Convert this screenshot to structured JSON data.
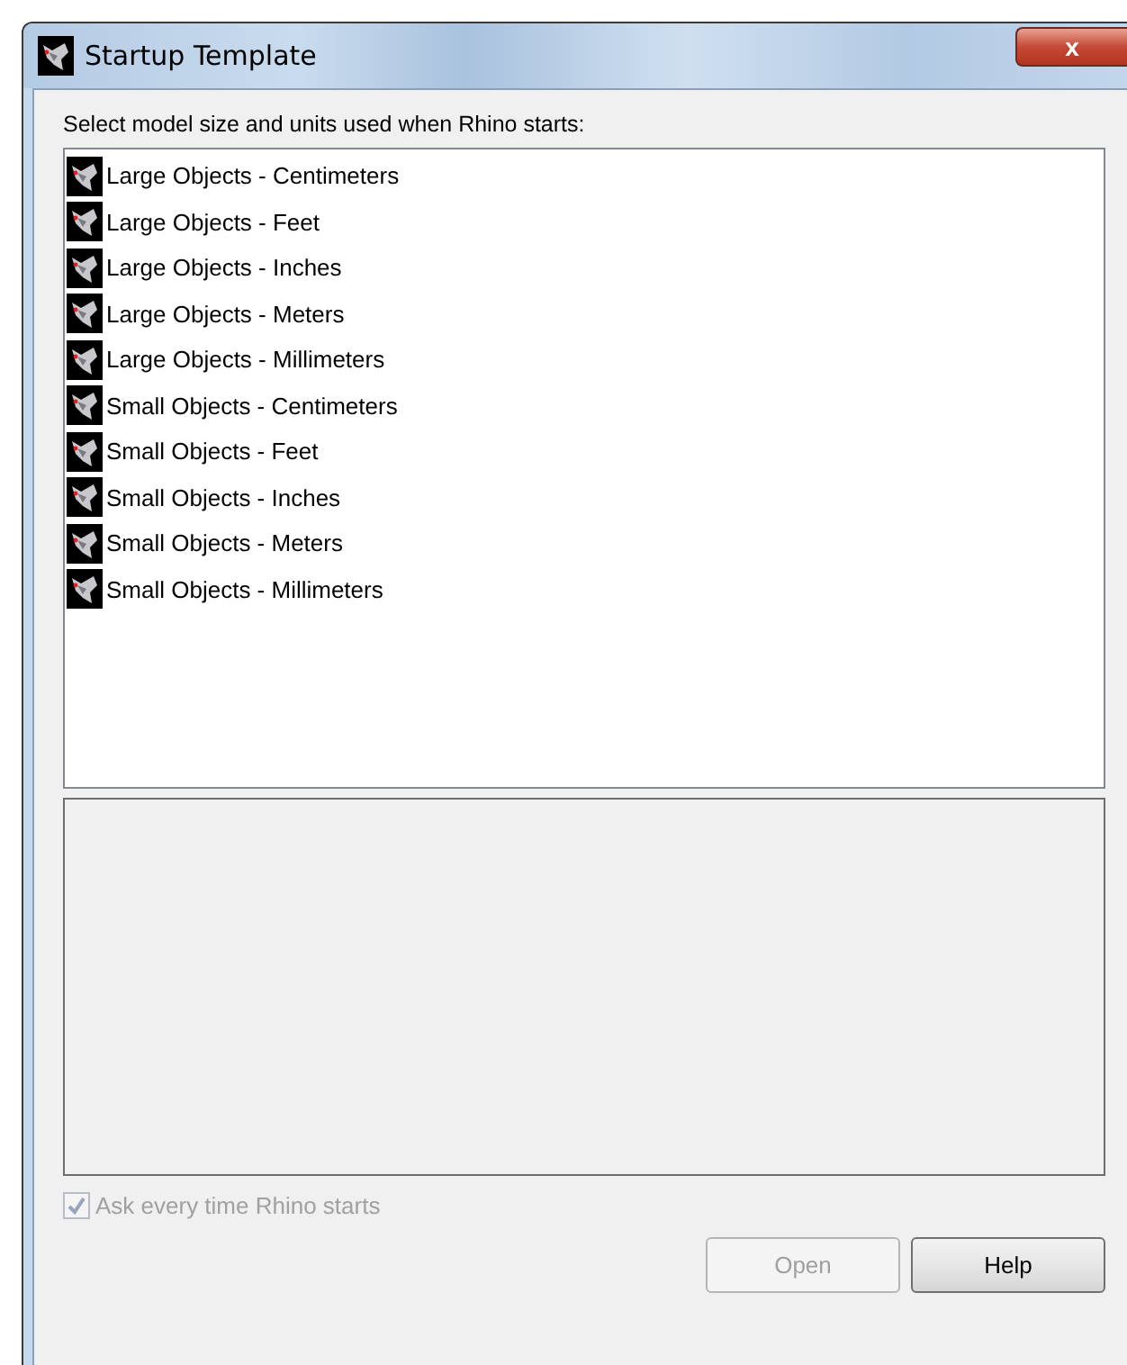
{
  "window": {
    "title": "Startup Template",
    "close": "x"
  },
  "prompt": "Select model size and units used when Rhino starts:",
  "templates": [
    {
      "label": "Large Objects - Centimeters",
      "selected": false
    },
    {
      "label": "Large Objects - Feet",
      "selected": false
    },
    {
      "label": "Large Objects - Inches",
      "selected": false
    },
    {
      "label": "Large Objects - Meters",
      "selected": false
    },
    {
      "label": "Large Objects - Millimeters",
      "selected": false
    },
    {
      "label": "Small Objects - Centimeters",
      "selected": false
    },
    {
      "label": "Small Objects - Feet",
      "selected": false
    },
    {
      "label": "Small Objects - Inches",
      "selected": false
    },
    {
      "label": "Small Objects - Meters",
      "selected": false
    },
    {
      "label": "Small Objects - Millimeters",
      "selected": false
    }
  ],
  "ask_checkbox": {
    "label": "Ask every time Rhino starts",
    "checked": true,
    "disabled": true
  },
  "buttons": [
    {
      "label": "Open",
      "disabled": true
    },
    {
      "label": "Help",
      "disabled": false
    }
  ]
}
